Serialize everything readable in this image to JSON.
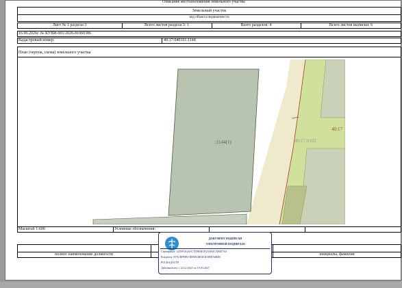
{
  "header": {
    "section_title": "Описание местоположения земельного участка",
    "object_name": "Земельный участок",
    "object_kind": "вид объекта недвижимости"
  },
  "sheet_row": {
    "sheet": "Лист № 1 раздела 3",
    "sheets_in_section": "Всего листов раздела 3: 1",
    "sections_total": "Всего разделов: 4",
    "sheets_total": "Всего листов выписки: 6"
  },
  "doc_number": "16.06.2026г. № КУВИ-001/2026-81060386",
  "cadastral": {
    "label": "Кадастровый номер:",
    "value": "40:17:040101:1144"
  },
  "plan": {
    "title": "План (чертеж, схема) земельного участка",
    "parcel_label": ":1144(1)",
    "neighbor_label": "40:17:0102",
    "edge_label": "40:17"
  },
  "footer": {
    "scale": "Масштаб 1:600",
    "legend": "Условные обозначения:",
    "position_label": "полное наименование должности",
    "name_label": "инициалы, фамилия"
  },
  "stamp": {
    "line1": "ДОКУМЕНТ ПОДПИСАН",
    "line2": "ЭЛЕКТРОННОЙ ПОДПИСЬЮ",
    "cert": "Сертификат: 1259F3A4A5C7D9B0E1F2A3B4C5D6E7A8",
    "owner": "Владелец: ПУБЛИЧНО-ПРАВОВАЯ КОМПАНИЯ",
    "org": "РОСКАДАСТР",
    "valid": "Действителен: с 24.12.2025 по 19.03.2027"
  },
  "colors": {
    "parcel_fill": "#b8c4b0",
    "road_fill": "#efeacb",
    "green_fill": "#cfe19a",
    "boundary_red": "#b23a3a"
  }
}
